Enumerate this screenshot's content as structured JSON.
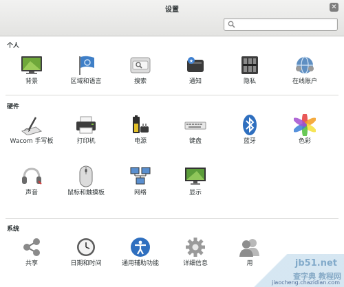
{
  "window": {
    "title": "设置",
    "close_glyph": "✕"
  },
  "search": {
    "placeholder": "",
    "value": ""
  },
  "sections": [
    {
      "title": "个人",
      "items": [
        {
          "label": "背景",
          "icon": "background-icon"
        },
        {
          "label": "区域和语言",
          "icon": "region-language-icon"
        },
        {
          "label": "搜索",
          "icon": "search-settings-icon"
        },
        {
          "label": "通知",
          "icon": "notifications-icon"
        },
        {
          "label": "隐私",
          "icon": "privacy-icon"
        },
        {
          "label": "在线账户",
          "icon": "online-accounts-icon"
        }
      ]
    },
    {
      "title": "硬件",
      "items": [
        {
          "label": "Wacom 手写板",
          "icon": "wacom-tablet-icon"
        },
        {
          "label": "打印机",
          "icon": "printer-icon"
        },
        {
          "label": "电源",
          "icon": "power-icon"
        },
        {
          "label": "键盘",
          "icon": "keyboard-icon"
        },
        {
          "label": "蓝牙",
          "icon": "bluetooth-icon"
        },
        {
          "label": "色彩",
          "icon": "color-icon"
        },
        {
          "label": "声音",
          "icon": "sound-icon"
        },
        {
          "label": "鼠标和触摸板",
          "icon": "mouse-touchpad-icon"
        },
        {
          "label": "网络",
          "icon": "network-icon"
        },
        {
          "label": "显示",
          "icon": "display-icon"
        }
      ]
    },
    {
      "title": "系统",
      "items": [
        {
          "label": "共享",
          "icon": "sharing-icon"
        },
        {
          "label": "日期和时间",
          "icon": "date-time-icon"
        },
        {
          "label": "通用辅助功能",
          "icon": "universal-access-icon"
        },
        {
          "label": "详细信息",
          "icon": "details-icon"
        },
        {
          "label": "用",
          "icon": "users-icon"
        }
      ]
    }
  ],
  "watermark": {
    "line1": "jb51.net",
    "line2": "查字典 教程网",
    "line3": "jiaocheng.chazidian.com"
  }
}
